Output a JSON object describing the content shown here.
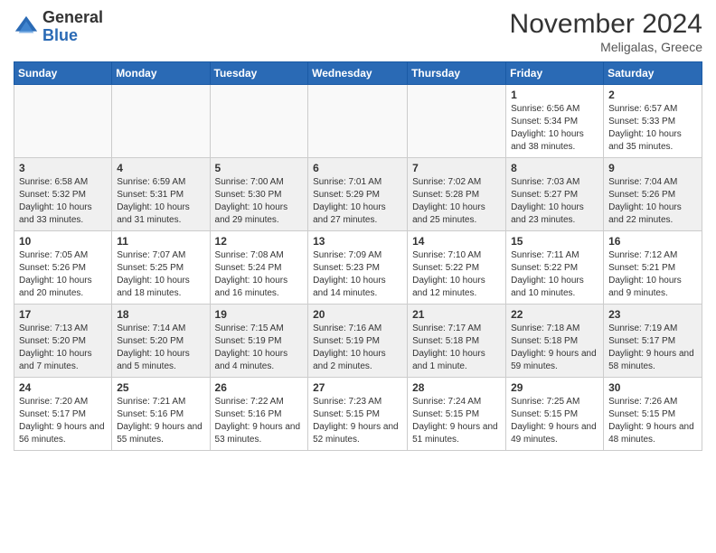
{
  "header": {
    "logo_general": "General",
    "logo_blue": "Blue",
    "month_title": "November 2024",
    "location": "Meligalas, Greece"
  },
  "days_of_week": [
    "Sunday",
    "Monday",
    "Tuesday",
    "Wednesday",
    "Thursday",
    "Friday",
    "Saturday"
  ],
  "weeks": [
    {
      "days": [
        {
          "num": "",
          "info": ""
        },
        {
          "num": "",
          "info": ""
        },
        {
          "num": "",
          "info": ""
        },
        {
          "num": "",
          "info": ""
        },
        {
          "num": "",
          "info": ""
        },
        {
          "num": "1",
          "info": "Sunrise: 6:56 AM\nSunset: 5:34 PM\nDaylight: 10 hours and 38 minutes."
        },
        {
          "num": "2",
          "info": "Sunrise: 6:57 AM\nSunset: 5:33 PM\nDaylight: 10 hours and 35 minutes."
        }
      ]
    },
    {
      "days": [
        {
          "num": "3",
          "info": "Sunrise: 6:58 AM\nSunset: 5:32 PM\nDaylight: 10 hours and 33 minutes."
        },
        {
          "num": "4",
          "info": "Sunrise: 6:59 AM\nSunset: 5:31 PM\nDaylight: 10 hours and 31 minutes."
        },
        {
          "num": "5",
          "info": "Sunrise: 7:00 AM\nSunset: 5:30 PM\nDaylight: 10 hours and 29 minutes."
        },
        {
          "num": "6",
          "info": "Sunrise: 7:01 AM\nSunset: 5:29 PM\nDaylight: 10 hours and 27 minutes."
        },
        {
          "num": "7",
          "info": "Sunrise: 7:02 AM\nSunset: 5:28 PM\nDaylight: 10 hours and 25 minutes."
        },
        {
          "num": "8",
          "info": "Sunrise: 7:03 AM\nSunset: 5:27 PM\nDaylight: 10 hours and 23 minutes."
        },
        {
          "num": "9",
          "info": "Sunrise: 7:04 AM\nSunset: 5:26 PM\nDaylight: 10 hours and 22 minutes."
        }
      ]
    },
    {
      "days": [
        {
          "num": "10",
          "info": "Sunrise: 7:05 AM\nSunset: 5:26 PM\nDaylight: 10 hours and 20 minutes."
        },
        {
          "num": "11",
          "info": "Sunrise: 7:07 AM\nSunset: 5:25 PM\nDaylight: 10 hours and 18 minutes."
        },
        {
          "num": "12",
          "info": "Sunrise: 7:08 AM\nSunset: 5:24 PM\nDaylight: 10 hours and 16 minutes."
        },
        {
          "num": "13",
          "info": "Sunrise: 7:09 AM\nSunset: 5:23 PM\nDaylight: 10 hours and 14 minutes."
        },
        {
          "num": "14",
          "info": "Sunrise: 7:10 AM\nSunset: 5:22 PM\nDaylight: 10 hours and 12 minutes."
        },
        {
          "num": "15",
          "info": "Sunrise: 7:11 AM\nSunset: 5:22 PM\nDaylight: 10 hours and 10 minutes."
        },
        {
          "num": "16",
          "info": "Sunrise: 7:12 AM\nSunset: 5:21 PM\nDaylight: 10 hours and 9 minutes."
        }
      ]
    },
    {
      "days": [
        {
          "num": "17",
          "info": "Sunrise: 7:13 AM\nSunset: 5:20 PM\nDaylight: 10 hours and 7 minutes."
        },
        {
          "num": "18",
          "info": "Sunrise: 7:14 AM\nSunset: 5:20 PM\nDaylight: 10 hours and 5 minutes."
        },
        {
          "num": "19",
          "info": "Sunrise: 7:15 AM\nSunset: 5:19 PM\nDaylight: 10 hours and 4 minutes."
        },
        {
          "num": "20",
          "info": "Sunrise: 7:16 AM\nSunset: 5:19 PM\nDaylight: 10 hours and 2 minutes."
        },
        {
          "num": "21",
          "info": "Sunrise: 7:17 AM\nSunset: 5:18 PM\nDaylight: 10 hours and 1 minute."
        },
        {
          "num": "22",
          "info": "Sunrise: 7:18 AM\nSunset: 5:18 PM\nDaylight: 9 hours and 59 minutes."
        },
        {
          "num": "23",
          "info": "Sunrise: 7:19 AM\nSunset: 5:17 PM\nDaylight: 9 hours and 58 minutes."
        }
      ]
    },
    {
      "days": [
        {
          "num": "24",
          "info": "Sunrise: 7:20 AM\nSunset: 5:17 PM\nDaylight: 9 hours and 56 minutes."
        },
        {
          "num": "25",
          "info": "Sunrise: 7:21 AM\nSunset: 5:16 PM\nDaylight: 9 hours and 55 minutes."
        },
        {
          "num": "26",
          "info": "Sunrise: 7:22 AM\nSunset: 5:16 PM\nDaylight: 9 hours and 53 minutes."
        },
        {
          "num": "27",
          "info": "Sunrise: 7:23 AM\nSunset: 5:15 PM\nDaylight: 9 hours and 52 minutes."
        },
        {
          "num": "28",
          "info": "Sunrise: 7:24 AM\nSunset: 5:15 PM\nDaylight: 9 hours and 51 minutes."
        },
        {
          "num": "29",
          "info": "Sunrise: 7:25 AM\nSunset: 5:15 PM\nDaylight: 9 hours and 49 minutes."
        },
        {
          "num": "30",
          "info": "Sunrise: 7:26 AM\nSunset: 5:15 PM\nDaylight: 9 hours and 48 minutes."
        }
      ]
    }
  ]
}
